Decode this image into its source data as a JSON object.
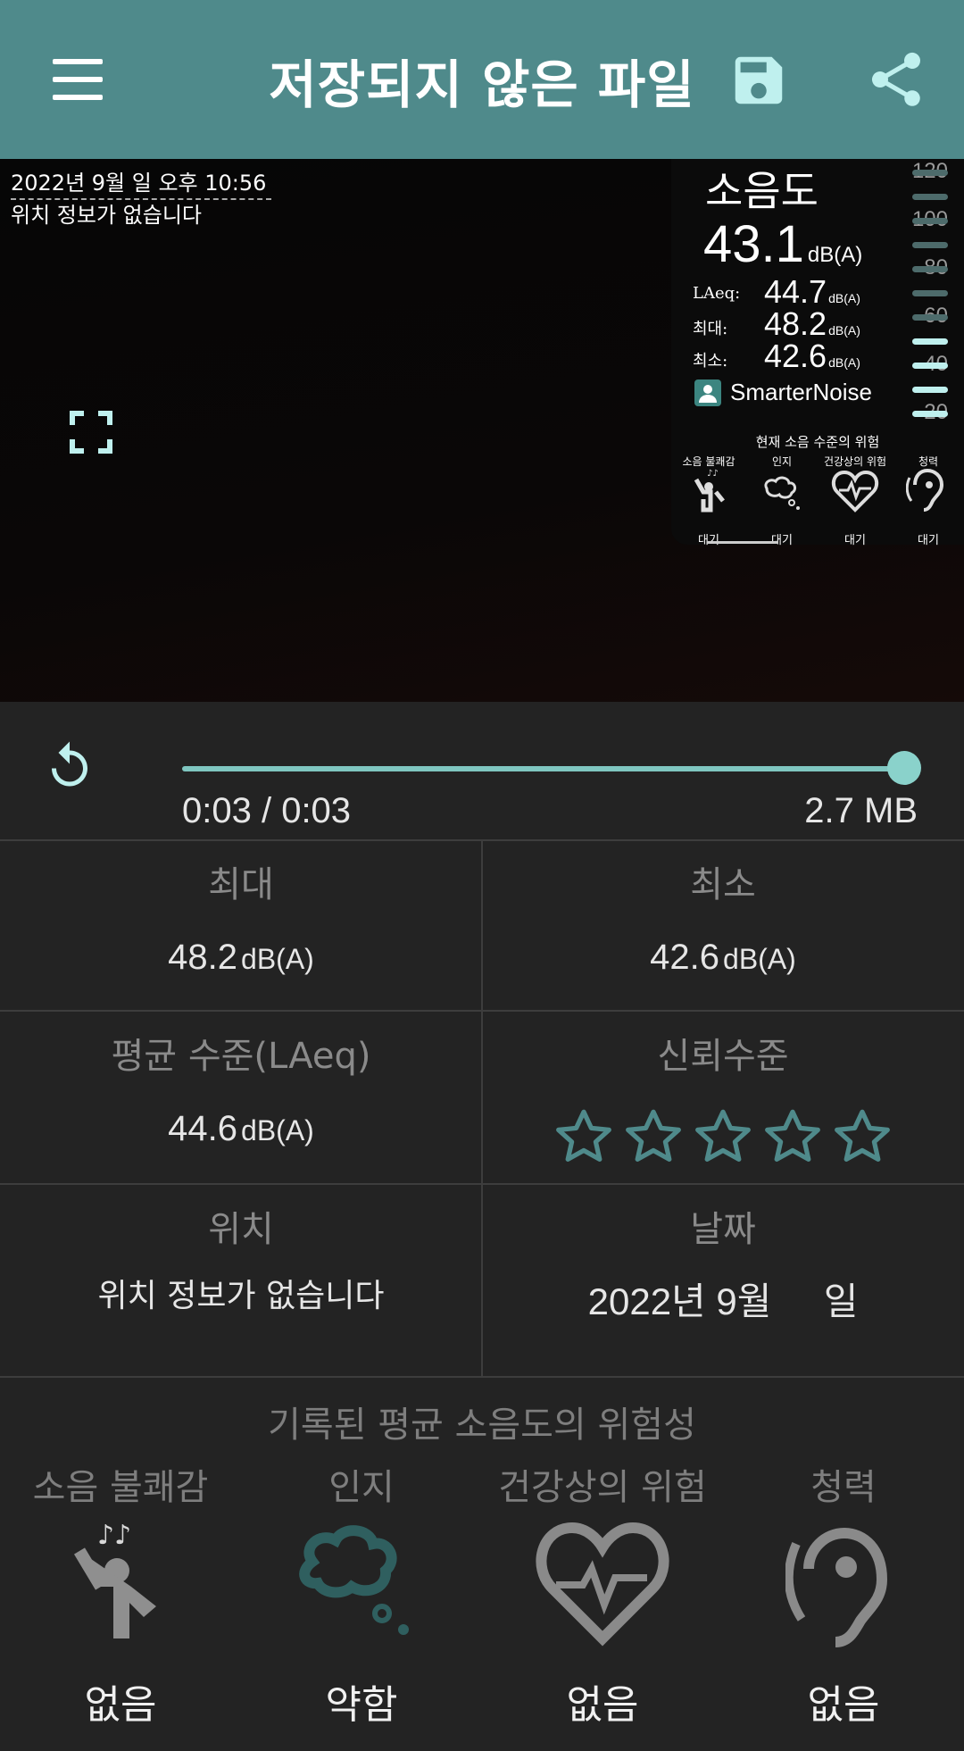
{
  "appbar": {
    "title": "저장되지 않은 파일"
  },
  "video": {
    "stamp_datetime": "2022년 9월 일 오후 10:56",
    "stamp_location": "위치 정보가 없습니다",
    "overlay": {
      "label": "소음도",
      "current_value": "43.1",
      "current_unit": "dB(A)",
      "laeq_label": "LAeq:",
      "laeq_value": "44.7",
      "max_label": "최대:",
      "max_value": "48.2",
      "min_label": "최소:",
      "min_value": "42.6",
      "unit_small": "dB(A)",
      "brand": "SmarterNoise",
      "risk_title": "현재 소음 수준의 위험",
      "categories": [
        {
          "name": "소음 불쾌감",
          "status": "대기"
        },
        {
          "name": "인지",
          "status": "대기"
        },
        {
          "name": "건강상의 위험",
          "status": "대기"
        },
        {
          "name": "청력",
          "status": "대기"
        }
      ],
      "scale_ticks": [
        "120",
        "100",
        "80",
        "60",
        "40",
        "20"
      ],
      "scale_level_db": 43.1
    }
  },
  "player": {
    "time": "0:03 / 0:03",
    "size": "2.7 MB",
    "progress": 1.0
  },
  "stats": {
    "max": {
      "label": "최대",
      "value": "48.2",
      "unit": "dB(A)"
    },
    "min": {
      "label": "최소",
      "value": "42.6",
      "unit": "dB(A)"
    },
    "avg": {
      "label": "평균 수준(LAeq)",
      "value": "44.6",
      "unit": "dB(A)"
    },
    "confidence": {
      "label": "신뢰수준",
      "stars_filled": 0,
      "stars_total": 5
    },
    "location": {
      "label": "위치",
      "value": "위치 정보가 없습니다"
    },
    "date": {
      "label": "날짜",
      "value": "2022년 9월     일"
    }
  },
  "risk": {
    "title": "기록된 평균 소음도의 위험성",
    "items": [
      {
        "name": "소음 불쾌감",
        "level": "없음"
      },
      {
        "name": "인지",
        "level": "약함"
      },
      {
        "name": "건강상의 위험",
        "level": "없음"
      },
      {
        "name": "청력",
        "level": "없음"
      }
    ]
  },
  "colors": {
    "appbar": "#4f8a8b",
    "accent": "#8ad2cb",
    "background": "#232323",
    "star": "#4f8a8b",
    "cognition_icon": "#2f5f5f"
  }
}
